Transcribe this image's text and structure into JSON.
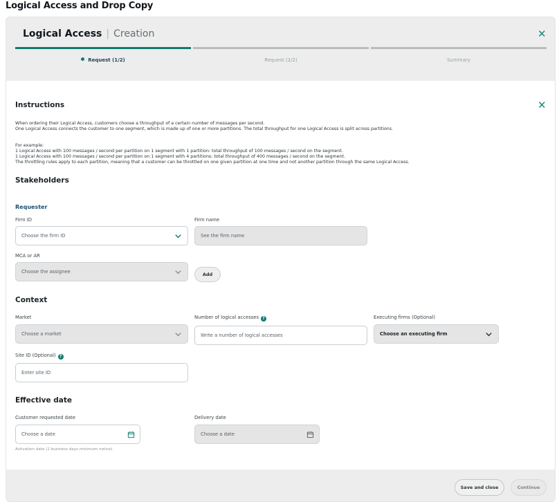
{
  "page": {
    "title": "Logical Access and Drop Copy"
  },
  "header": {
    "title": "Logical Access",
    "subtitle": "Creation"
  },
  "steps": [
    {
      "label": "Request (1/2)",
      "active": true
    },
    {
      "label": "Request (2/2)",
      "active": false
    },
    {
      "label": "Summary",
      "active": false
    }
  ],
  "instructions": {
    "heading": "Instructions",
    "lines": [
      "When ordering their Logical Access, customers choose a throughput of a certain number of messages per second.",
      "One Logical Access connects the customer to one segment, which is made up of one or more partitions. The total throughput for one Logical Access is split across partitions.",
      "For example:",
      "1 Logical Access with 100 messages / second per partition on 1 segment with 1 partition: total throughput of 100 messages / second on the segment.",
      "1 Logical Access with 100 messages / second per partition on 1 segment with 4 partitions: total throughput of 400 messages / second on the segment.",
      "The throttling rules apply to each partition, meaning that a customer can be throttled on one given partition at one time and not another partition through the same Logical Access."
    ]
  },
  "stakeholders": {
    "heading": "Stakeholders",
    "requester_heading": "Requester",
    "firm_id": {
      "label": "Firm ID",
      "placeholder": "Choose the firm ID"
    },
    "firm_name": {
      "label": "Firm name",
      "placeholder": "See the firm name"
    },
    "mca_ar": {
      "label": "MCA or AR",
      "placeholder": "Choose the assignee"
    },
    "add_label": "Add"
  },
  "context": {
    "heading": "Context",
    "market": {
      "label": "Market",
      "placeholder": "Choose a market"
    },
    "num_logical_accesses": {
      "label": "Number of logical accesses",
      "placeholder": "Write a number of logical accesses"
    },
    "executing_firms": {
      "label": "Executing firms (Optional)",
      "placeholder": "Choose an executing firm"
    },
    "site_id": {
      "label": "Site ID (Optional)",
      "placeholder": "Enter site ID"
    }
  },
  "effective_date": {
    "heading": "Effective date",
    "customer_requested": {
      "label": "Customer requested date",
      "placeholder": "Choose a date"
    },
    "delivery": {
      "label": "Delivery date",
      "placeholder": "Choose a date"
    },
    "hint": "Activation date (2 business days minimum notice)"
  },
  "footer": {
    "save_label": "Save and close",
    "continue_label": "Continue"
  },
  "icons": {
    "close": "close-icon",
    "dropdown": "chevron-down-icon",
    "calendar": "calendar-icon",
    "help": "help-icon"
  },
  "colors": {
    "accent": "#0e7c6e",
    "subheading": "#1c4f70",
    "panel": "#ededed",
    "disabled_field": "#e5e5e5"
  }
}
